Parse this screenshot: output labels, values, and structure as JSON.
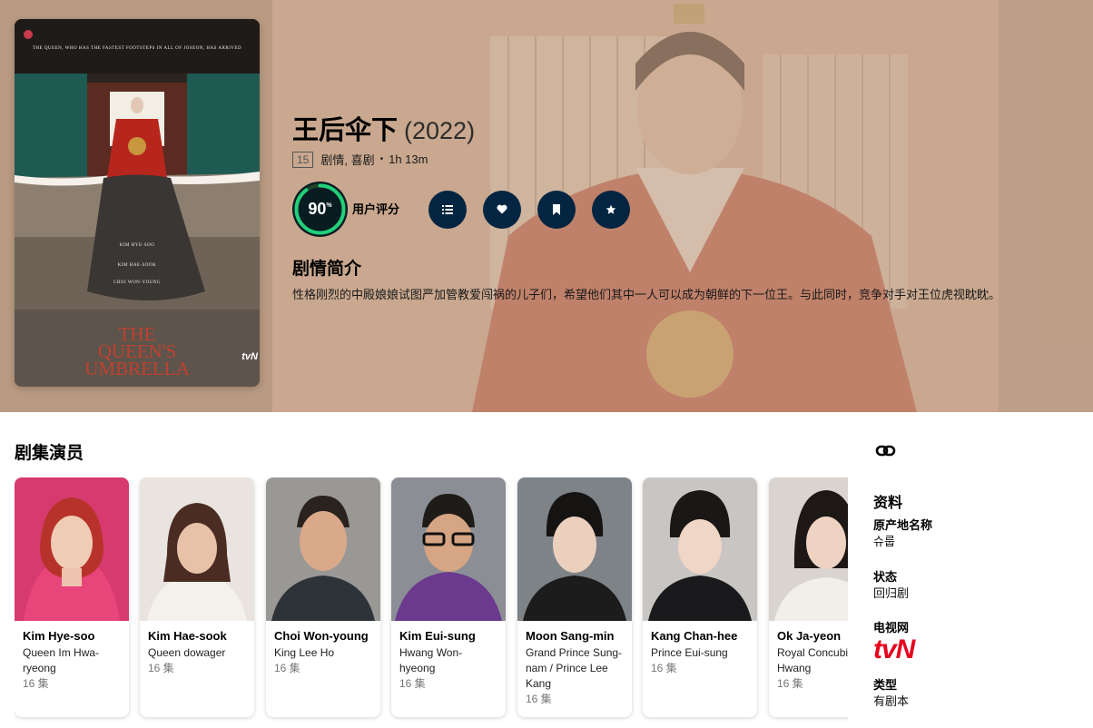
{
  "poster": {
    "tagline": "THE QUEEN, WHO HAS THE FASTEST FOOTSTEPS IN ALL OF JOSEON, HAS ARRIVED",
    "cast_lines": [
      "KIM HYE-SOO",
      "KIM HAE-SOOK",
      "CHOI WON-YOUNG"
    ],
    "title_lines": [
      "THE",
      "QUEEN'S",
      "UMBRELLA"
    ],
    "brand": "tvN"
  },
  "show": {
    "title": "王后伞下",
    "year": "(2022)",
    "certification": "15",
    "genres": "剧情, 喜剧",
    "separator": "•",
    "runtime": "1h 13m"
  },
  "rating": {
    "score": "90",
    "percent_sign": "%",
    "fraction": 0.9,
    "label": "用户评分",
    "ring_color": "#21d07a",
    "ring_track_color": "#204529"
  },
  "actions": [
    {
      "icon": "list-icon"
    },
    {
      "icon": "heart-icon"
    },
    {
      "icon": "bookmark-icon"
    },
    {
      "icon": "star-icon"
    }
  ],
  "overview": {
    "heading": "剧情简介",
    "text": "性格刚烈的中殿娘娘试图严加管教爱闯祸的儿子们，希望他们其中一人可以成为朝鲜的下一位王。与此同时，竞争对手对王位虎视眈眈。"
  },
  "cast": {
    "heading": "剧集演员",
    "members": [
      {
        "name": "Kim Hye-soo",
        "role": "Queen Im Hwa-ryeong",
        "episodes": "16 集"
      },
      {
        "name": "Kim Hae-sook",
        "role": "Queen dowager",
        "episodes": "16 集"
      },
      {
        "name": "Choi Won-young",
        "role": "King Lee Ho",
        "episodes": "16 集"
      },
      {
        "name": "Kim Eui-sung",
        "role": "Hwang Won-hyeong",
        "episodes": "16 集"
      },
      {
        "name": "Moon Sang-min",
        "role": "Grand Prince Sung-nam / Prince Lee Kang",
        "episodes": "16 集"
      },
      {
        "name": "Kang Chan-hee",
        "role": "Prince Eui-sung",
        "episodes": "16 集"
      },
      {
        "name": "Ok Ja-yeon",
        "role": "Royal Concubine Hwang",
        "episodes": "16 集"
      }
    ]
  },
  "sidebar": {
    "link_icon": "link-icon",
    "heading": "资料",
    "original_name_label": "原产地名称",
    "original_name_value": "슈룹",
    "status_label": "状态",
    "status_value": "回归剧",
    "network_label": "电视网",
    "network_logo_text": "tvN",
    "type_label": "类型",
    "type_value": "有剧本"
  },
  "colors": {
    "hero_tint": "#c9a88f",
    "action_button": "#032541",
    "network_logo": "#e6001e"
  }
}
